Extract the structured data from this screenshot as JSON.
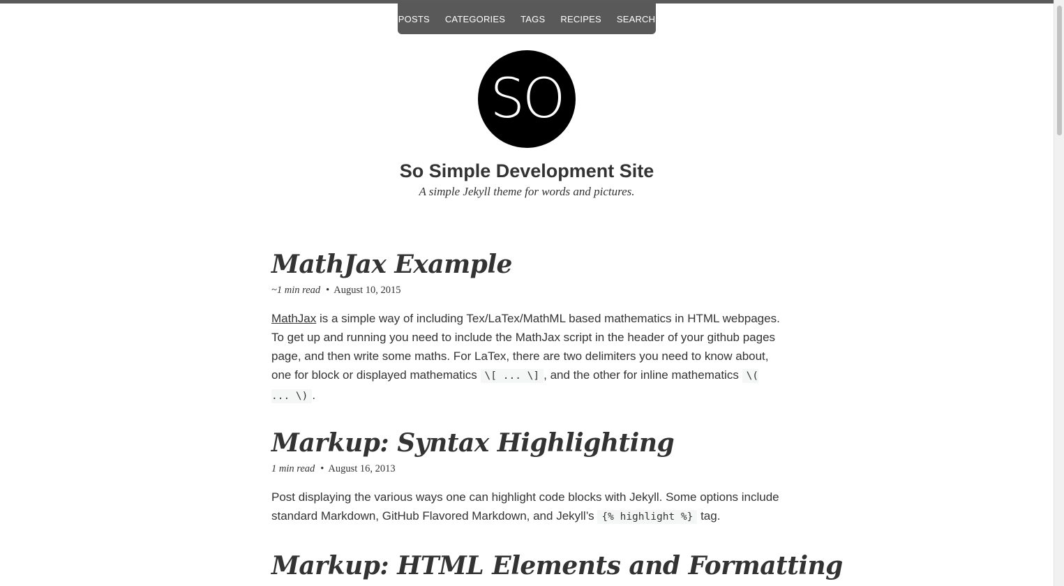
{
  "nav": {
    "items": [
      {
        "label": "POSTS"
      },
      {
        "label": "CATEGORIES"
      },
      {
        "label": "TAGS"
      },
      {
        "label": "RECIPES"
      },
      {
        "label": "SEARCH"
      }
    ]
  },
  "site": {
    "logo_text": "SO",
    "title": "So Simple Development Site",
    "description": "A simple Jekyll theme for words and pictures."
  },
  "posts": [
    {
      "title": "MathJax Example",
      "read_time": "~1 min read",
      "date": "August 10, 2015",
      "excerpt": {
        "link": "MathJax",
        "text1": " is a simple way of including Tex/LaTex/MathML based mathematics in HTML webpages. To get up and running you need to include the MathJax script in the header of your github pages page, and then write some maths. For LaTex, there are two delimiters you need to know about, one for block or displayed mathematics ",
        "code1": "\\[ ... \\]",
        "text2": ", and the other for inline mathematics ",
        "code2": "\\( ... \\)",
        "text3": "."
      }
    },
    {
      "title": "Markup: Syntax Highlighting",
      "read_time": "1 min read",
      "date": "August 16, 2013",
      "excerpt": {
        "text1": "Post displaying the various ways one can highlight code blocks with Jekyll. Some options include standard Markdown, GitHub Flavored Markdown, and Jekyll’s ",
        "code1": "{% highlight %}",
        "text2": " tag."
      }
    },
    {
      "title": "Markup: HTML Elements and Formatting"
    }
  ]
}
